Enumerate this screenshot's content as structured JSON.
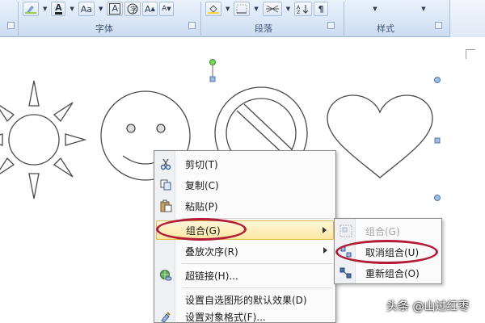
{
  "ribbon": {
    "groups": [
      {
        "label": "字体"
      },
      {
        "label": "段落"
      },
      {
        "label": "样式"
      }
    ],
    "font_buttons": [
      "A",
      "Aa",
      "A",
      "A",
      "A"
    ]
  },
  "context_menu": {
    "items": [
      {
        "label": "剪切(T)",
        "icon": "scissors-icon",
        "enabled": true
      },
      {
        "label": "复制(C)",
        "icon": "copy-icon",
        "enabled": true
      },
      {
        "label": "粘贴(P)",
        "icon": "paste-icon",
        "enabled": true
      },
      {
        "label": "组合(G)",
        "icon": "none",
        "enabled": true,
        "has_submenu": true,
        "highlighted": true
      },
      {
        "label": "叠放次序(R)",
        "icon": "none",
        "enabled": true,
        "has_submenu": true
      },
      {
        "label": "超链接(H)...",
        "icon": "globe-link-icon",
        "enabled": true
      },
      {
        "label": "设置自选图形的默认效果(D)",
        "icon": "none",
        "enabled": true
      },
      {
        "label": "设置对象格式(F)...",
        "icon": "format-icon",
        "enabled": true
      }
    ]
  },
  "submenu": {
    "items": [
      {
        "label": "组合(G)",
        "icon": "group-icon",
        "enabled": false
      },
      {
        "label": "取消组合(U)",
        "icon": "ungroup-icon",
        "enabled": true
      },
      {
        "label": "重新组合(O)",
        "icon": "regroup-icon",
        "enabled": true
      }
    ]
  },
  "annotations": {
    "color": "#b31c39"
  },
  "watermark": {
    "text": "头条 @山过红枣"
  }
}
